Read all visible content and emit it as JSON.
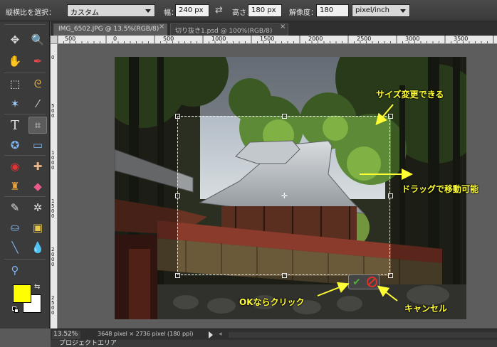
{
  "options_bar": {
    "ratio_label": "縦横比を選択：",
    "ratio_value": "カスタム",
    "width_label": "幅：",
    "width_value": "240 px",
    "height_label": "高さ：",
    "height_value": "180 px",
    "resolution_label": "解像度：",
    "resolution_value": "180",
    "resolution_unit": "pixel/inch"
  },
  "tabs": [
    {
      "label": "IMG_6502.JPG @ 13.5%(RGB/8)"
    },
    {
      "label": "切り抜き1.psd @ 100%(RGB/8)"
    }
  ],
  "ruler": {
    "top": [
      "500",
      "0",
      "500",
      "1000",
      "1500",
      "2000",
      "2500",
      "3000",
      "3500"
    ],
    "left": [
      "0",
      "500",
      "1000",
      "1500",
      "2000",
      "2500"
    ]
  },
  "annotations": {
    "resize": "サイズ変更できる",
    "drag": "ドラッグで移動可能",
    "ok": "OKならクリック",
    "cancel": "キャンセル"
  },
  "status": {
    "zoom": "13.52%",
    "info": "3648 pixel × 2736 pixel (180 ppi)"
  },
  "project_bin": {
    "label": "プロジェクトエリア"
  },
  "colors": {
    "foreground": "#ffff00",
    "background": "#ffffff",
    "annotation": "#ffff33"
  }
}
